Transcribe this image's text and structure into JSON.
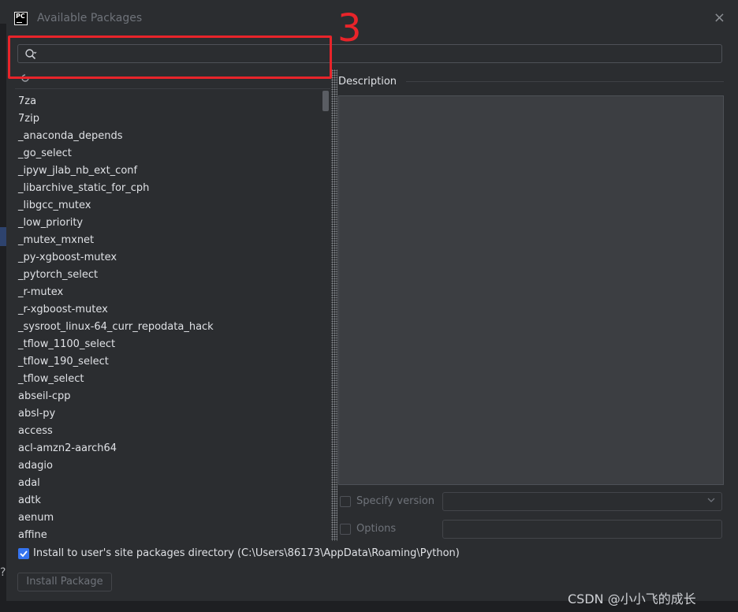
{
  "window": {
    "app_icon_text": "PC",
    "title": "Available Packages",
    "close_symbol": "×"
  },
  "search": {
    "value": "",
    "placeholder": ""
  },
  "annotation": {
    "number": "3",
    "color": "#e8242a"
  },
  "packages": [
    "7za",
    "7zip",
    "_anaconda_depends",
    "_go_select",
    "_ipyw_jlab_nb_ext_conf",
    "_libarchive_static_for_cph",
    "_libgcc_mutex",
    "_low_priority",
    "_mutex_mxnet",
    "_py-xgboost-mutex",
    "_pytorch_select",
    "_r-mutex",
    "_r-xgboost-mutex",
    "_sysroot_linux-64_curr_repodata_hack",
    "_tflow_1100_select",
    "_tflow_190_select",
    "_tflow_select",
    "abseil-cpp",
    "absl-py",
    "access",
    "acl-amzn2-aarch64",
    "adagio",
    "adal",
    "adtk",
    "aenum",
    "affine"
  ],
  "description": {
    "label": "Description"
  },
  "options": {
    "specify_version_label": "Specify version",
    "options_label": "Options",
    "install_user_site_label": "Install to user's site packages directory (C:\\Users\\86173\\AppData\\Roaming\\Python)",
    "install_user_site_checked": true
  },
  "buttons": {
    "install_label": "Install Package"
  },
  "watermark": "CSDN @小小飞的成长",
  "help_symbol": "?",
  "colors": {
    "accent": "#3574f0",
    "background": "#2b2d30",
    "panel": "#3c3e42"
  }
}
